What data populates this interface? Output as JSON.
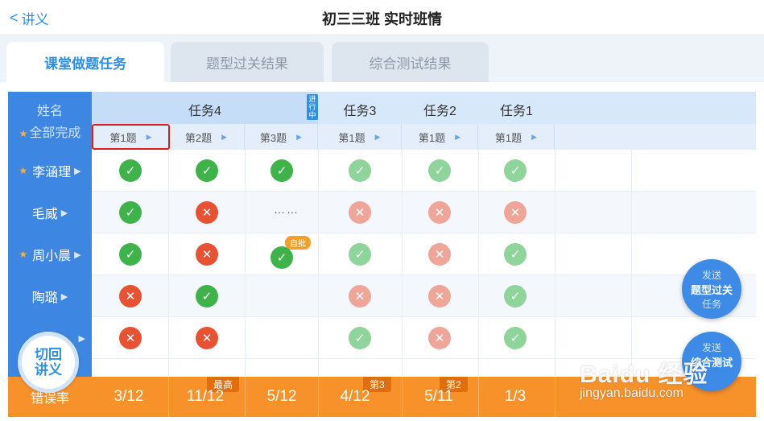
{
  "header": {
    "back_label": "讲义",
    "title": "初三三班 实时班情"
  },
  "tabs": [
    "课堂做题任务",
    "题型过关结果",
    "综合测试结果"
  ],
  "name_header": {
    "line1": "姓名",
    "line2": "全部完成"
  },
  "tasks": {
    "t4": "任务4",
    "t3": "任务3",
    "t2": "任务2",
    "t1": "任务1",
    "in_progress": "进行中"
  },
  "questions": [
    "第1题",
    "第2题",
    "第3题",
    "第1题",
    "第1题",
    "第1题"
  ],
  "students": [
    "李涵理",
    "毛威",
    "周小晨",
    "陶璐",
    ""
  ],
  "rows": [
    [
      "ok",
      "ok",
      "ok",
      "ok-f",
      "ok-f",
      "ok-f"
    ],
    [
      "ok",
      "bad",
      "dots",
      "bad-f",
      "bad-f",
      "bad-f"
    ],
    [
      "ok",
      "bad",
      "ok-self",
      "ok-f",
      "bad-f",
      "ok-f"
    ],
    [
      "bad",
      "ok",
      "",
      "bad-f",
      "bad-f",
      "ok-f"
    ],
    [
      "bad",
      "bad",
      "",
      "ok-f",
      "bad-f",
      "ok-f"
    ]
  ],
  "labels": {
    "dots": "……",
    "self_check": "自批"
  },
  "error_rate": {
    "label": "错误率",
    "values": [
      "3/12",
      "11/12",
      "5/12",
      "4/12",
      "5/11",
      "1/3"
    ],
    "rank_highest": "最高",
    "rank_3": "第3",
    "rank_2": "第2"
  },
  "fab_pass": {
    "top": "发送",
    "main": "题型过关",
    "bottom": "任务"
  },
  "fab_test": {
    "top": "发送",
    "main": "综合测试"
  },
  "back_fab": {
    "line1": "切回",
    "line2": "讲义"
  },
  "watermark": {
    "line1": "Baidu 经验",
    "line2": "jingyan.baidu.com"
  },
  "colors": {
    "primary": "#3d87e2",
    "ok": "#3db34a",
    "bad": "#e85233",
    "orange": "#f7922b"
  }
}
